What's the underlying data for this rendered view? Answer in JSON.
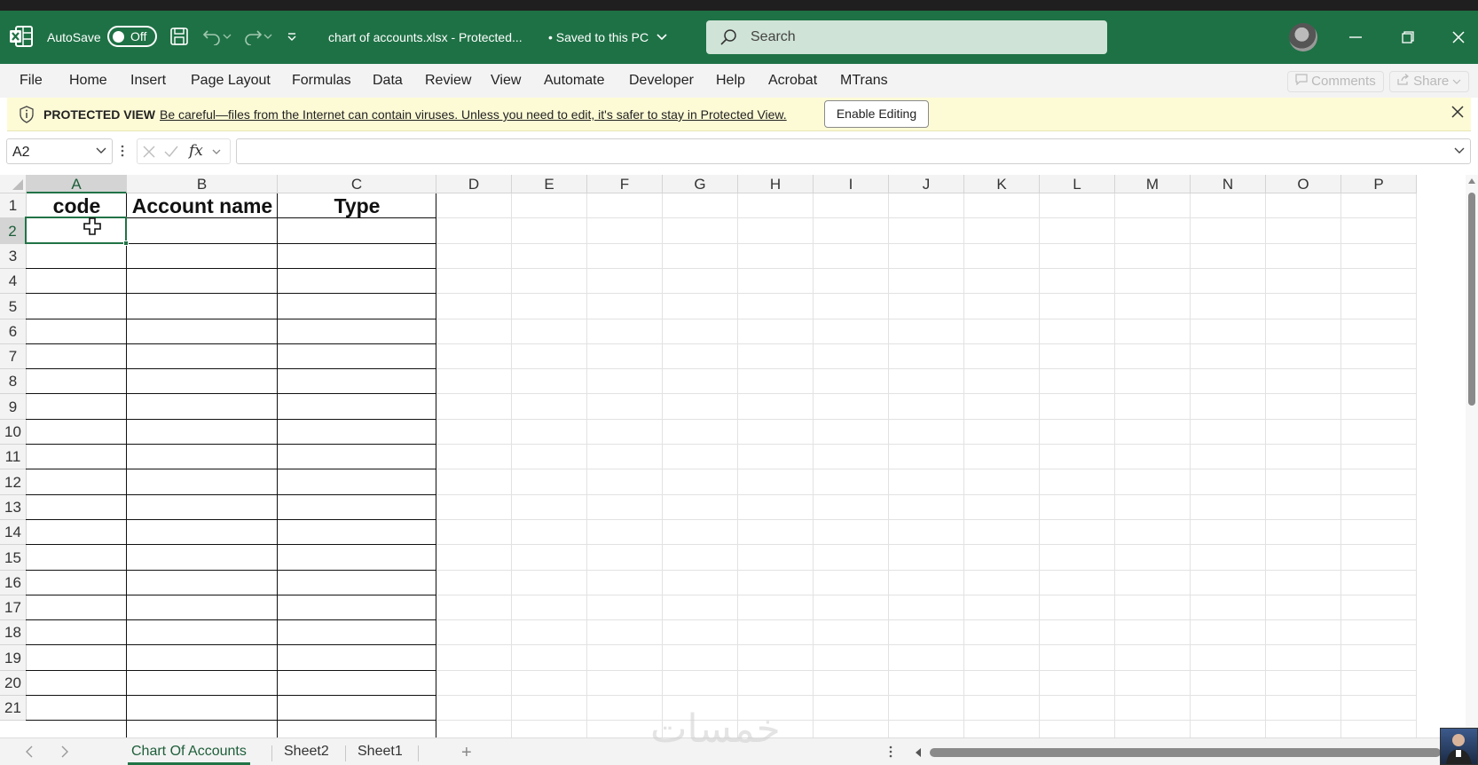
{
  "titlebar": {
    "autosave_label": "AutoSave",
    "autosave_state": "Off",
    "filename": "chart of accounts.xlsx  -  Protected...",
    "saved_status": "•  Saved to this PC",
    "search_placeholder": "Search",
    "accent_color": "#1e7145"
  },
  "ribbon": {
    "tabs": [
      "File",
      "Home",
      "Insert",
      "Page Layout",
      "Formulas",
      "Data",
      "Review",
      "View",
      "Automate",
      "Developer",
      "Help",
      "Acrobat",
      "MTrans"
    ],
    "comments_label": "Comments",
    "share_label": "Share"
  },
  "protected_view": {
    "title": "PROTECTED VIEW",
    "message": "Be careful—files from the Internet can contain viruses. Unless you need to edit, it's safer to stay in Protected View.",
    "button": "Enable Editing",
    "bg_color": "#fdfbd5"
  },
  "formula_bar": {
    "name_box": "A2",
    "fx_label": "fx",
    "value": ""
  },
  "sheet": {
    "columns": [
      "A",
      "B",
      "C",
      "D",
      "E",
      "F",
      "G",
      "H",
      "I",
      "J",
      "K",
      "L",
      "M",
      "N",
      "O",
      "P"
    ],
    "rows": [
      "1",
      "2",
      "3",
      "4",
      "5",
      "6",
      "7",
      "8",
      "9",
      "10",
      "11",
      "12",
      "13",
      "14",
      "15",
      "16",
      "17",
      "18",
      "19",
      "20",
      "21"
    ],
    "headers": {
      "A1": "code",
      "B1": "Account name",
      "C1": "Type"
    },
    "selected_cell": "A2",
    "selection_color": "#217346"
  },
  "sheet_tabs": {
    "tabs": [
      "Chart Of Accounts",
      "Sheet2",
      "Sheet1"
    ],
    "active": "Chart Of Accounts"
  },
  "watermark": "خمسات"
}
